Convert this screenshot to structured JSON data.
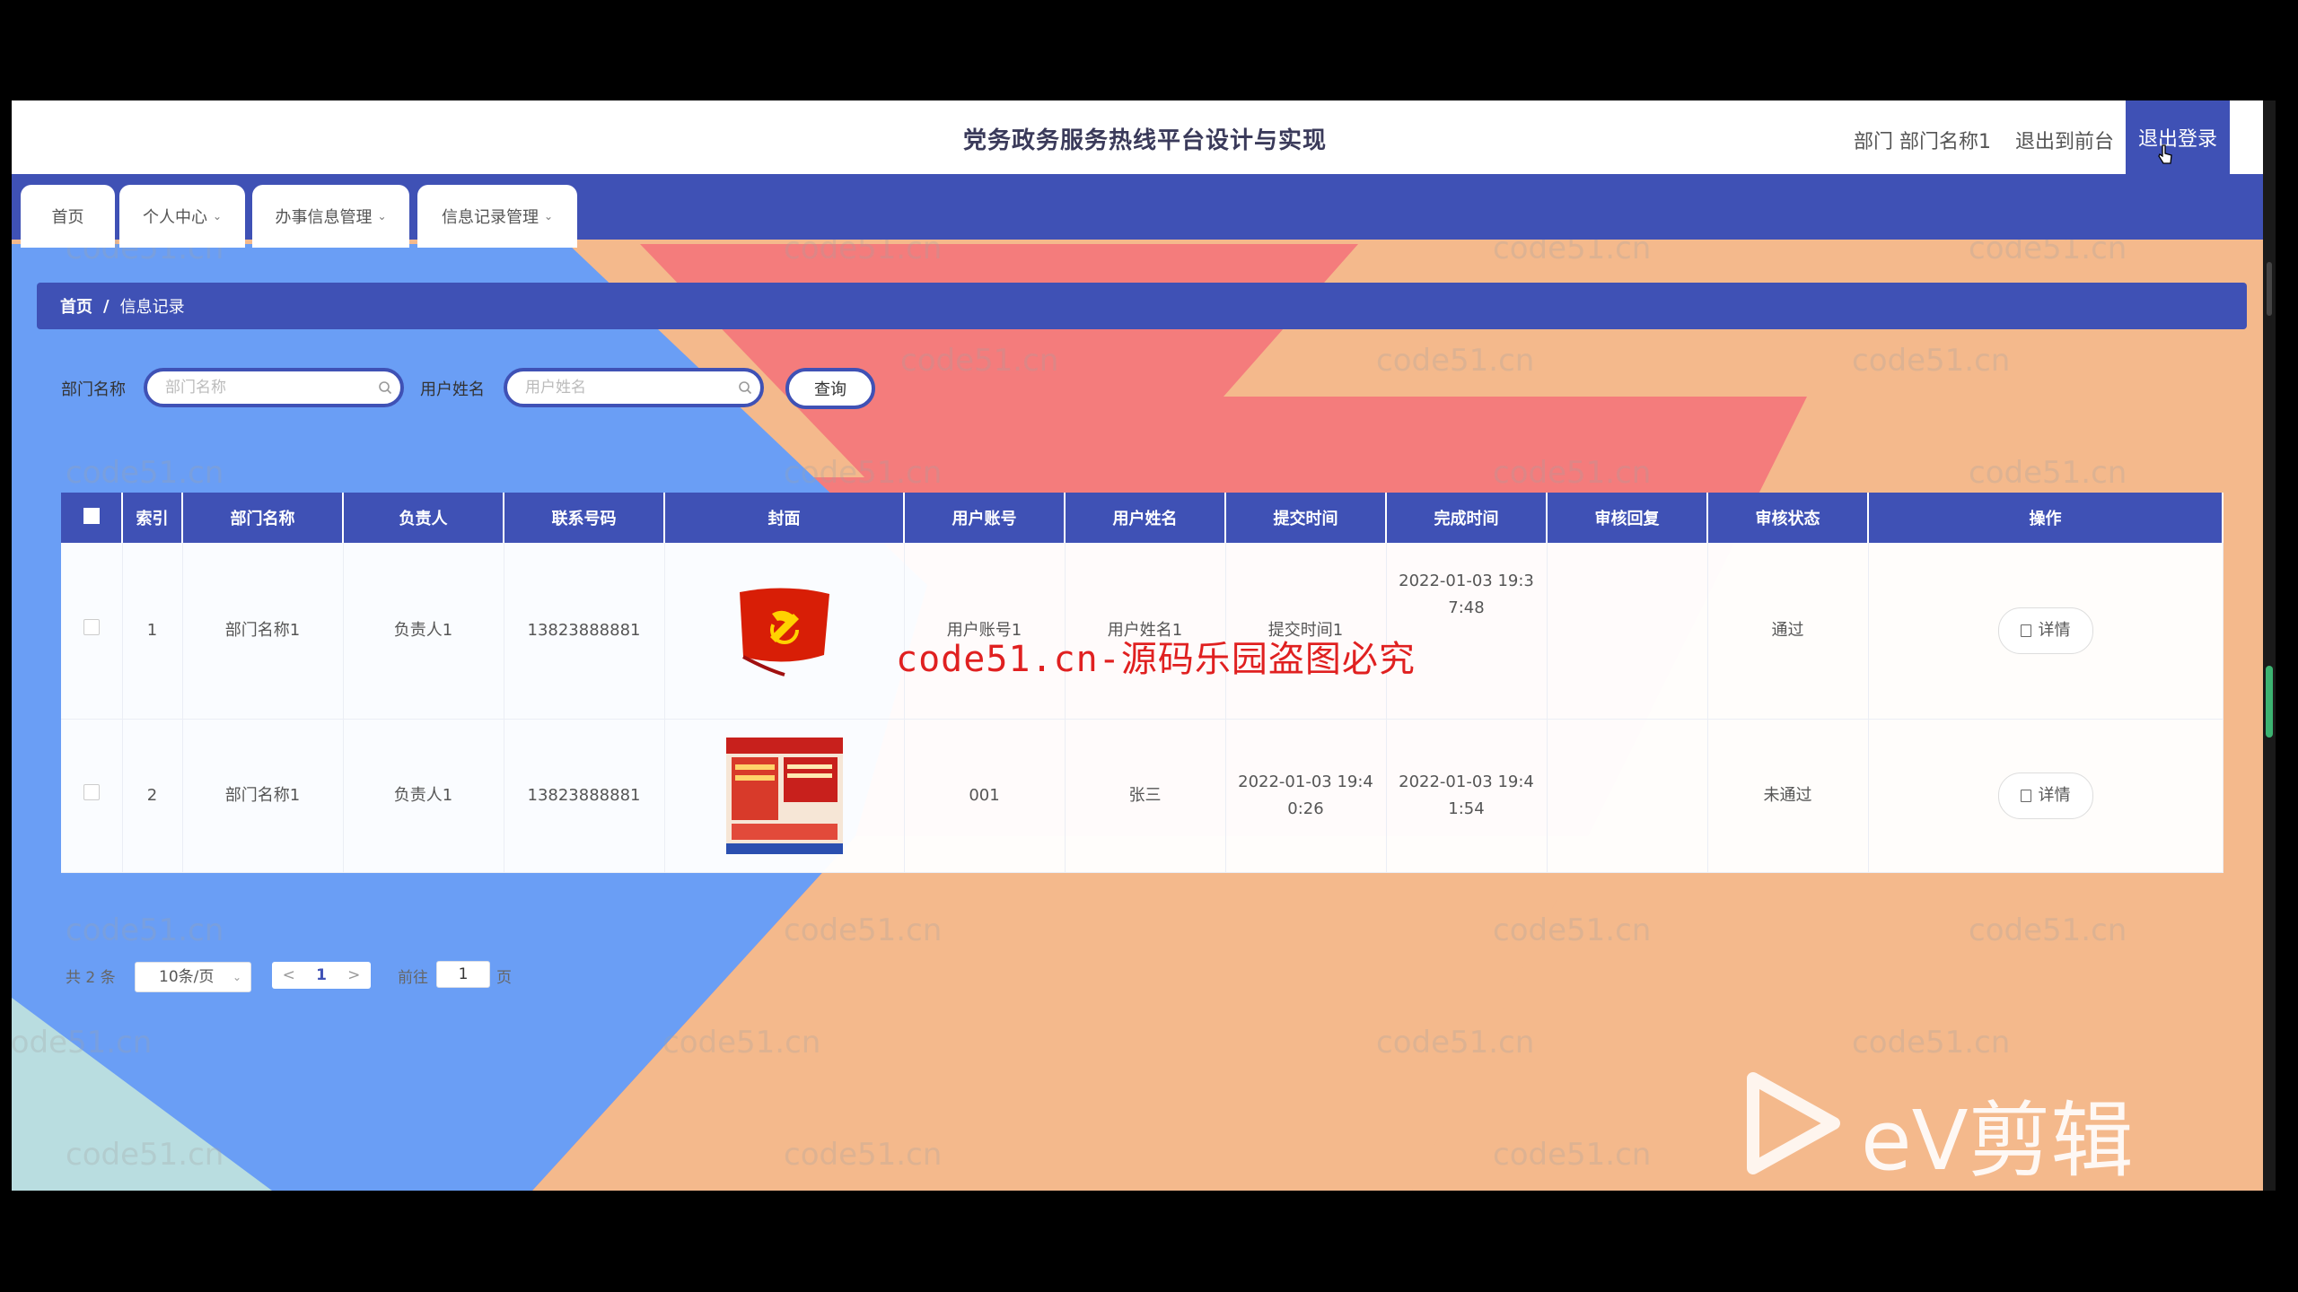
{
  "header": {
    "title": "党务政务服务热线平台设计与实现",
    "dept_label": "部门 部门名称1",
    "front_link": "退出到前台",
    "logout": "退出登录"
  },
  "nav": {
    "tabs": [
      {
        "label": "首页"
      },
      {
        "label": "个人中心"
      },
      {
        "label": "办事信息管理"
      },
      {
        "label": "信息记录管理"
      }
    ]
  },
  "breadcrumb": {
    "home": "首页",
    "sep": "/",
    "current": "信息记录"
  },
  "search": {
    "dept_label": "部门名称",
    "dept_placeholder": "部门名称",
    "user_label": "用户姓名",
    "user_placeholder": "用户姓名",
    "button": "查询"
  },
  "table": {
    "headers": [
      "索引",
      "部门名称",
      "负责人",
      "联系号码",
      "封面",
      "用户账号",
      "用户姓名",
      "提交时间",
      "完成时间",
      "审核回复",
      "审核状态",
      "操作"
    ],
    "rows": [
      {
        "index": "1",
        "dept": "部门名称1",
        "leader": "负责人1",
        "phone": "13823888881",
        "cover": "party-flag-image",
        "account": "用户账号1",
        "username": "用户姓名1",
        "submit_l1": "提交时间1",
        "submit_l2": "",
        "finish_l1": "2022-01-03 19:3",
        "finish_l2": "7:48",
        "reply": "",
        "status": "通过",
        "action": "详情"
      },
      {
        "index": "2",
        "dept": "部门名称1",
        "leader": "负责人1",
        "phone": "13823888881",
        "cover": "party-poster-image",
        "account": "001",
        "username": "张三",
        "submit_l1": "2022-01-03 19:4",
        "submit_l2": "0:26",
        "finish_l1": "2022-01-03 19:4",
        "finish_l2": "1:54",
        "reply": "",
        "status": "未通过",
        "action": "详情"
      }
    ]
  },
  "pagination": {
    "total": "共 2 条",
    "page_size": "10条/页",
    "current": "1",
    "goto_label": "前往",
    "goto_value": "1",
    "page_suffix": "页"
  },
  "overlay": {
    "watermark": "code51.cn",
    "red_watermark": "code51.cn-源码乐园盗图必究",
    "editor_logo": "eV剪辑"
  },
  "colors": {
    "primary": "#3f51b5",
    "bg_blue": "#6a9ef5",
    "bg_salmon": "#f47c7c",
    "bg_peach": "#f4b98c",
    "bg_teal": "#b9dde0"
  }
}
